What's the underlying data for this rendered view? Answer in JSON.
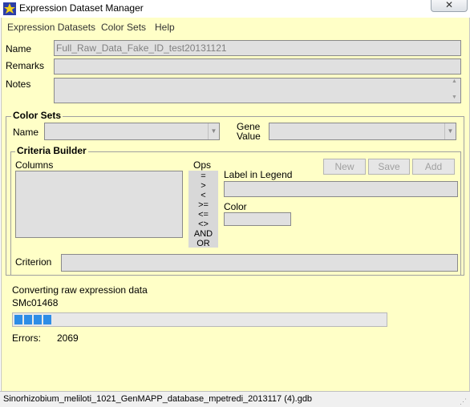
{
  "window": {
    "title": "Expression Dataset Manager",
    "close_glyph": "✕"
  },
  "menu": [
    "Expression Datasets",
    "Color Sets",
    "Help"
  ],
  "dataset": {
    "name_label": "Name",
    "name_value": "Full_Raw_Data_Fake_ID_test20131121",
    "remarks_label": "Remarks",
    "remarks_value": "",
    "notes_label": "Notes",
    "notes_value": ""
  },
  "color_sets": {
    "title": "Color Sets",
    "name_label": "Name",
    "gene_value_label_1": "Gene",
    "gene_value_label_2": "Value"
  },
  "criteria": {
    "title": "Criteria Builder",
    "columns_label": "Columns",
    "ops_label": "Ops",
    "ops": [
      "=",
      ">",
      "<",
      ">=",
      "<=",
      "<>",
      "AND",
      "OR"
    ],
    "label_in_legend": "Label in Legend",
    "color_label": "Color",
    "buttons": {
      "new": "New",
      "save": "Save",
      "add": "Add"
    },
    "criterion_label": "Criterion"
  },
  "progress": {
    "status": "Converting raw expression data",
    "current_item": "SMc01468",
    "fraction": 0.1,
    "errors_label": "Errors:",
    "errors_value": "2069",
    "color": "#2e8de6"
  },
  "statusbar": {
    "text": "Sinorhizobium_meliloti_1021_GenMAPP_database_mpetredi_2013117 (4).gdb"
  },
  "icons": {
    "app": "app-icon",
    "close": "close-icon"
  }
}
